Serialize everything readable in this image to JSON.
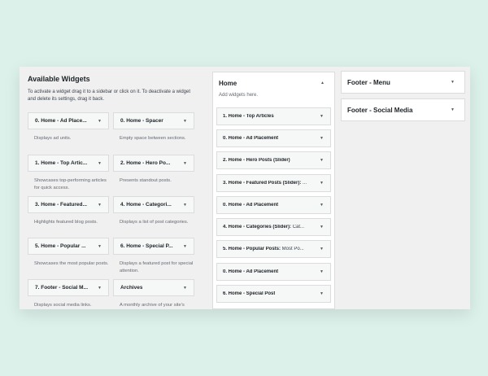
{
  "available": {
    "title": "Available Widgets",
    "description": "To activate a widget drag it to a sidebar or click on it. To deactivate a widget and delete its settings, drag it back.",
    "widgets": [
      {
        "label": "0. Home - Ad Place...",
        "desc": "Displays ad units."
      },
      {
        "label": "0. Home - Spacer",
        "desc": "Empty space between sections."
      },
      {
        "label": "1. Home - Top Artic...",
        "desc": "Showcases top-performing articles for quick access."
      },
      {
        "label": "2. Home - Hero Po...",
        "desc": "Presents standout posts."
      },
      {
        "label": "3. Home - Featured...",
        "desc": "Highlights featured blog posts."
      },
      {
        "label": "4. Home - Categori...",
        "desc": "Displays a list of post categories."
      },
      {
        "label": "5. Home - Popular ...",
        "desc": "Showcases the most popular posts."
      },
      {
        "label": "6. Home - Special P...",
        "desc": "Displays a featured post for special attention."
      },
      {
        "label": "7. Footer - Social M...",
        "desc": "Displays social media links."
      },
      {
        "label": "Archives",
        "desc": "A monthly archive of your site's Posts."
      }
    ]
  },
  "home_sidebar": {
    "title": "Home",
    "hint": "Add widgets here.",
    "items": [
      {
        "label": "1. Home - Top Articles",
        "sub": ""
      },
      {
        "label": "0. Home - Ad Placement",
        "sub": ""
      },
      {
        "label": "2. Home - Hero Posts (Slider)",
        "sub": ""
      },
      {
        "label": "3. Home - Featured Posts (Slider):",
        "sub": " ..."
      },
      {
        "label": "0. Home - Ad Placement",
        "sub": ""
      },
      {
        "label": "4. Home - Categories (Slider):",
        "sub": " Cat..."
      },
      {
        "label": "5. Home - Popular Posts:",
        "sub": " Most Po..."
      },
      {
        "label": "0. Home - Ad Placement",
        "sub": ""
      },
      {
        "label": "6. Home - Special Post",
        "sub": ""
      }
    ]
  },
  "footer_menu": {
    "title": "Footer - Menu"
  },
  "footer_social": {
    "title": "Footer - Social Media"
  },
  "icons": {
    "caret": "▼",
    "caret_up": "▲"
  }
}
